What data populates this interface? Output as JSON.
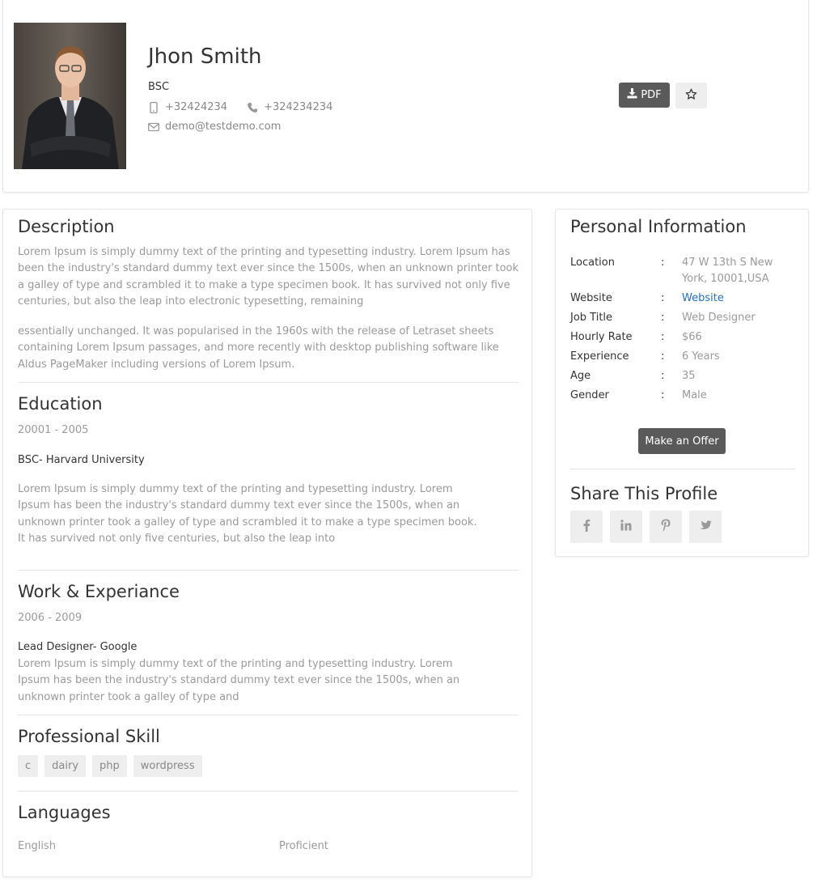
{
  "profile": {
    "name": "Jhon Smith",
    "degree": "BSC",
    "mobile": "+32424234",
    "phone": "+324234234",
    "email": "demo@testdemo.com",
    "pdf_label": "PDF"
  },
  "description": {
    "title": "Description",
    "para1": "Lorem Ipsum is simply dummy text of the printing and typesetting industry. Lorem Ipsum has been the industry's standard dummy text ever since the 1500s, when an unknown printer took a galley of type and scrambled it to make a type specimen book. It has survived not only five centuries, but also the leap into electronic typesetting, remaining",
    "para2": "essentially unchanged. It was popularised in the 1960s with the release of Letraset sheets containing Lorem Ipsum passages, and more recently with desktop publishing software like Aldus PageMaker including versions of Lorem Ipsum."
  },
  "education": {
    "title": "Education",
    "period": "20001 - 2005",
    "degree": "BSC- Harvard University",
    "text": "Lorem Ipsum is simply dummy text of the printing and typesetting industry. Lorem Ipsum has been the industry's standard dummy text ever since the 1500s, when an unknown printer took a galley of type and scrambled it to make a type specimen book. It has survived not only five centuries, but also the leap into"
  },
  "work": {
    "title": "Work & Experiance",
    "period": "2006 - 2009",
    "role": "Lead Designer- Google",
    "text": "Lorem Ipsum is simply dummy text of the printing and typesetting industry. Lorem Ipsum has been the industry's standard dummy text ever since the 1500s, when an unknown printer took a galley of type and"
  },
  "skills": {
    "title": "Professional Skill",
    "items": [
      "c",
      "dairy",
      "php",
      "wordpress"
    ]
  },
  "languages": {
    "title": "Languages",
    "language": "English",
    "level": "Proficient"
  },
  "personal": {
    "title": "Personal Information",
    "colon": ":",
    "rows": [
      {
        "label": "Location",
        "value": "47 W 13th S New York, 10001,USA"
      },
      {
        "label": "Website",
        "value": "Website"
      },
      {
        "label": "Job Title",
        "value": "Web Designer"
      },
      {
        "label": "Hourly Rate",
        "value": "$66"
      },
      {
        "label": "Experience",
        "value": "6 Years"
      },
      {
        "label": "Age",
        "value": "35"
      },
      {
        "label": "Gender",
        "value": "Male"
      }
    ],
    "offer_label": "Make an Offer"
  },
  "share": {
    "title": "Share This Profile",
    "icons": [
      "facebook-icon",
      "linkedin-icon",
      "pinterest-icon",
      "twitter-icon"
    ]
  },
  "colors": {
    "button_dark": "#5a5a5a",
    "link": "#2a6fb5",
    "muted_text": "#9a9a9a"
  }
}
